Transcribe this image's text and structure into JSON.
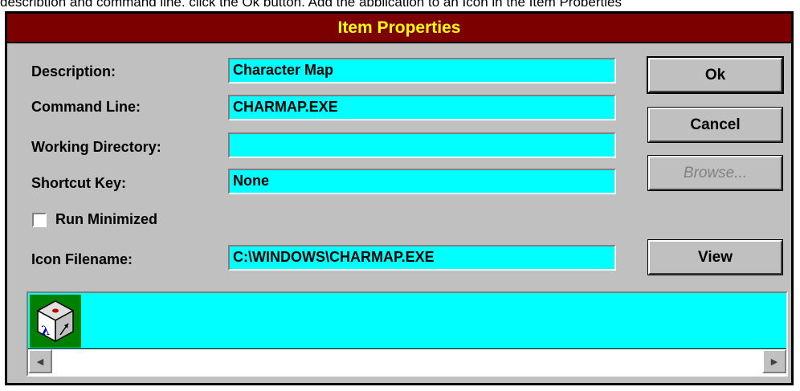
{
  "top_strip_text": "description and command line, click the Ok button. Add the application to an Icon in the Item Properties",
  "window": {
    "title": "Item Properties"
  },
  "labels": {
    "description": "Description:",
    "command_line": "Command Line:",
    "working_directory": "Working Directory:",
    "shortcut_key": "Shortcut Key:",
    "run_minimized": "Run Minimized",
    "icon_filename": "Icon Filename:"
  },
  "fields": {
    "description": "Character Map",
    "command_line": "CHARMAP.EXE",
    "working_directory": "",
    "shortcut_key": "None",
    "icon_filename": "C:\\WINDOWS\\CHARMAP.EXE"
  },
  "buttons": {
    "ok": "Ok",
    "cancel": "Cancel",
    "browse": "Browse...",
    "view": "View"
  },
  "checkbox": {
    "run_minimized_checked": false
  },
  "colors": {
    "title_bg": "#7d0000",
    "title_text": "#ffff00",
    "field_bg": "#00ffff",
    "dialog_bg": "#c0c0c0"
  }
}
